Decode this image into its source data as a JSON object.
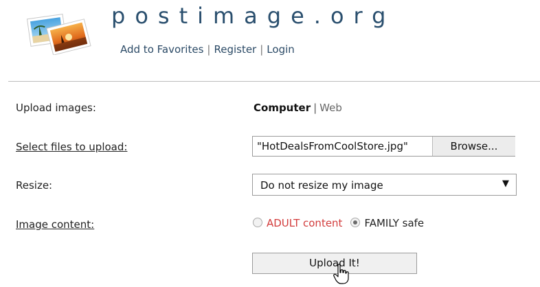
{
  "header": {
    "site_title": "postimage.org",
    "links": [
      "Add to Favorites",
      "Register",
      "Login"
    ],
    "link_separator": "|"
  },
  "form": {
    "upload_images_label": "Upload images:",
    "source_active": "Computer",
    "source_separator": "|",
    "source_inactive": "Web",
    "select_files_label": "Select files to upload:",
    "selected_file": "\"HotDealsFromCoolStore.jpg\"",
    "browse_label": "Browse...",
    "resize_label": "Resize:",
    "resize_value": "Do not resize my image",
    "image_content_label": "Image content:",
    "content_options": [
      "ADULT content",
      "FAMILY safe"
    ],
    "content_selected": "FAMILY safe",
    "upload_button": "Upload It!"
  },
  "colors": {
    "title": "#2a4f6e",
    "adult_label": "#d23b3b",
    "divider": "#bbbbbb"
  },
  "icons": {
    "logo": "photo-stack-logo-icon",
    "cursor": "hand-pointer-icon"
  }
}
